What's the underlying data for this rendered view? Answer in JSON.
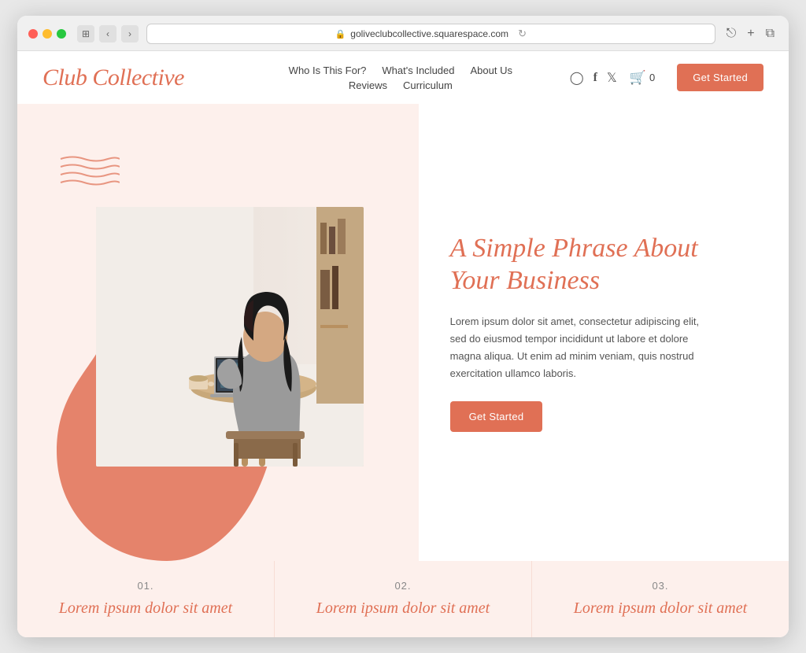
{
  "browser": {
    "url": "goliveclubcollective.squarespace.com",
    "traffic_lights": [
      "red",
      "yellow",
      "green"
    ]
  },
  "nav": {
    "logo": "Club Collective",
    "links_row1": [
      {
        "label": "Who Is This For?",
        "id": "who"
      },
      {
        "label": "What's Included",
        "id": "whats"
      },
      {
        "label": "About Us",
        "id": "about"
      }
    ],
    "links_row2": [
      {
        "label": "Reviews",
        "id": "reviews"
      },
      {
        "label": "Curriculum",
        "id": "curriculum"
      }
    ],
    "cart_label": "0",
    "cta_label": "Get Started"
  },
  "hero": {
    "title": "A Simple Phrase About Your Business",
    "body": "Lorem ipsum dolor sit amet, consectetur adipiscing elit, sed do eiusmod tempor incididunt ut labore et dolore magna aliqua. Ut enim ad minim veniam, quis nostrud exercitation ullamco laboris.",
    "cta_label": "Get Started"
  },
  "features": [
    {
      "number": "01.",
      "title": "Lorem ipsum dolor sit amet"
    },
    {
      "number": "02.",
      "title": "Lorem ipsum dolor sit amet"
    },
    {
      "number": "03.",
      "title": "Lorem ipsum dolor sit amet"
    }
  ],
  "colors": {
    "brand": "#e07055",
    "bg_light": "#fdf0ec"
  }
}
